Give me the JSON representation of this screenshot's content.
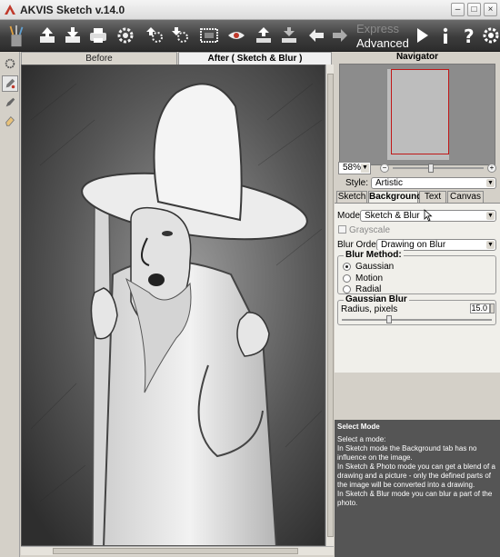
{
  "window": {
    "title": "AKVIS Sketch v.14.0"
  },
  "mode": {
    "express": "Express",
    "advanced": "Advanced"
  },
  "view_tabs": {
    "before": "Before",
    "after": "After ( Sketch & Blur )"
  },
  "navigator": {
    "title": "Navigator",
    "zoom": "58%"
  },
  "style": {
    "label": "Style:",
    "value": "Artistic"
  },
  "settings_tabs": [
    "Sketch",
    "Background",
    "Text",
    "Canvas"
  ],
  "background": {
    "mode_label": "Mode:",
    "mode_value": "Sketch & Blur",
    "grayscale_label": "Grayscale",
    "blur_order_label": "Blur Order:",
    "blur_order_value": "Drawing on Blur",
    "blur_method_title": "Blur Method:",
    "blur_methods": [
      "Gaussian",
      "Motion",
      "Radial"
    ],
    "selected_method": "Gaussian",
    "gaussian_title": "Gaussian Blur",
    "radius_label": "Radius, pixels",
    "radius_value": "15.0"
  },
  "help": {
    "title": "Select Mode",
    "lines": [
      "Select a mode:",
      "In Sketch mode the Background tab has no influence on the image.",
      "In Sketch & Photo mode you can get a blend of a drawing and a picture - only the defined parts of the image will be converted into a drawing.",
      "In Sketch & Blur mode you can blur a part of the photo."
    ]
  }
}
